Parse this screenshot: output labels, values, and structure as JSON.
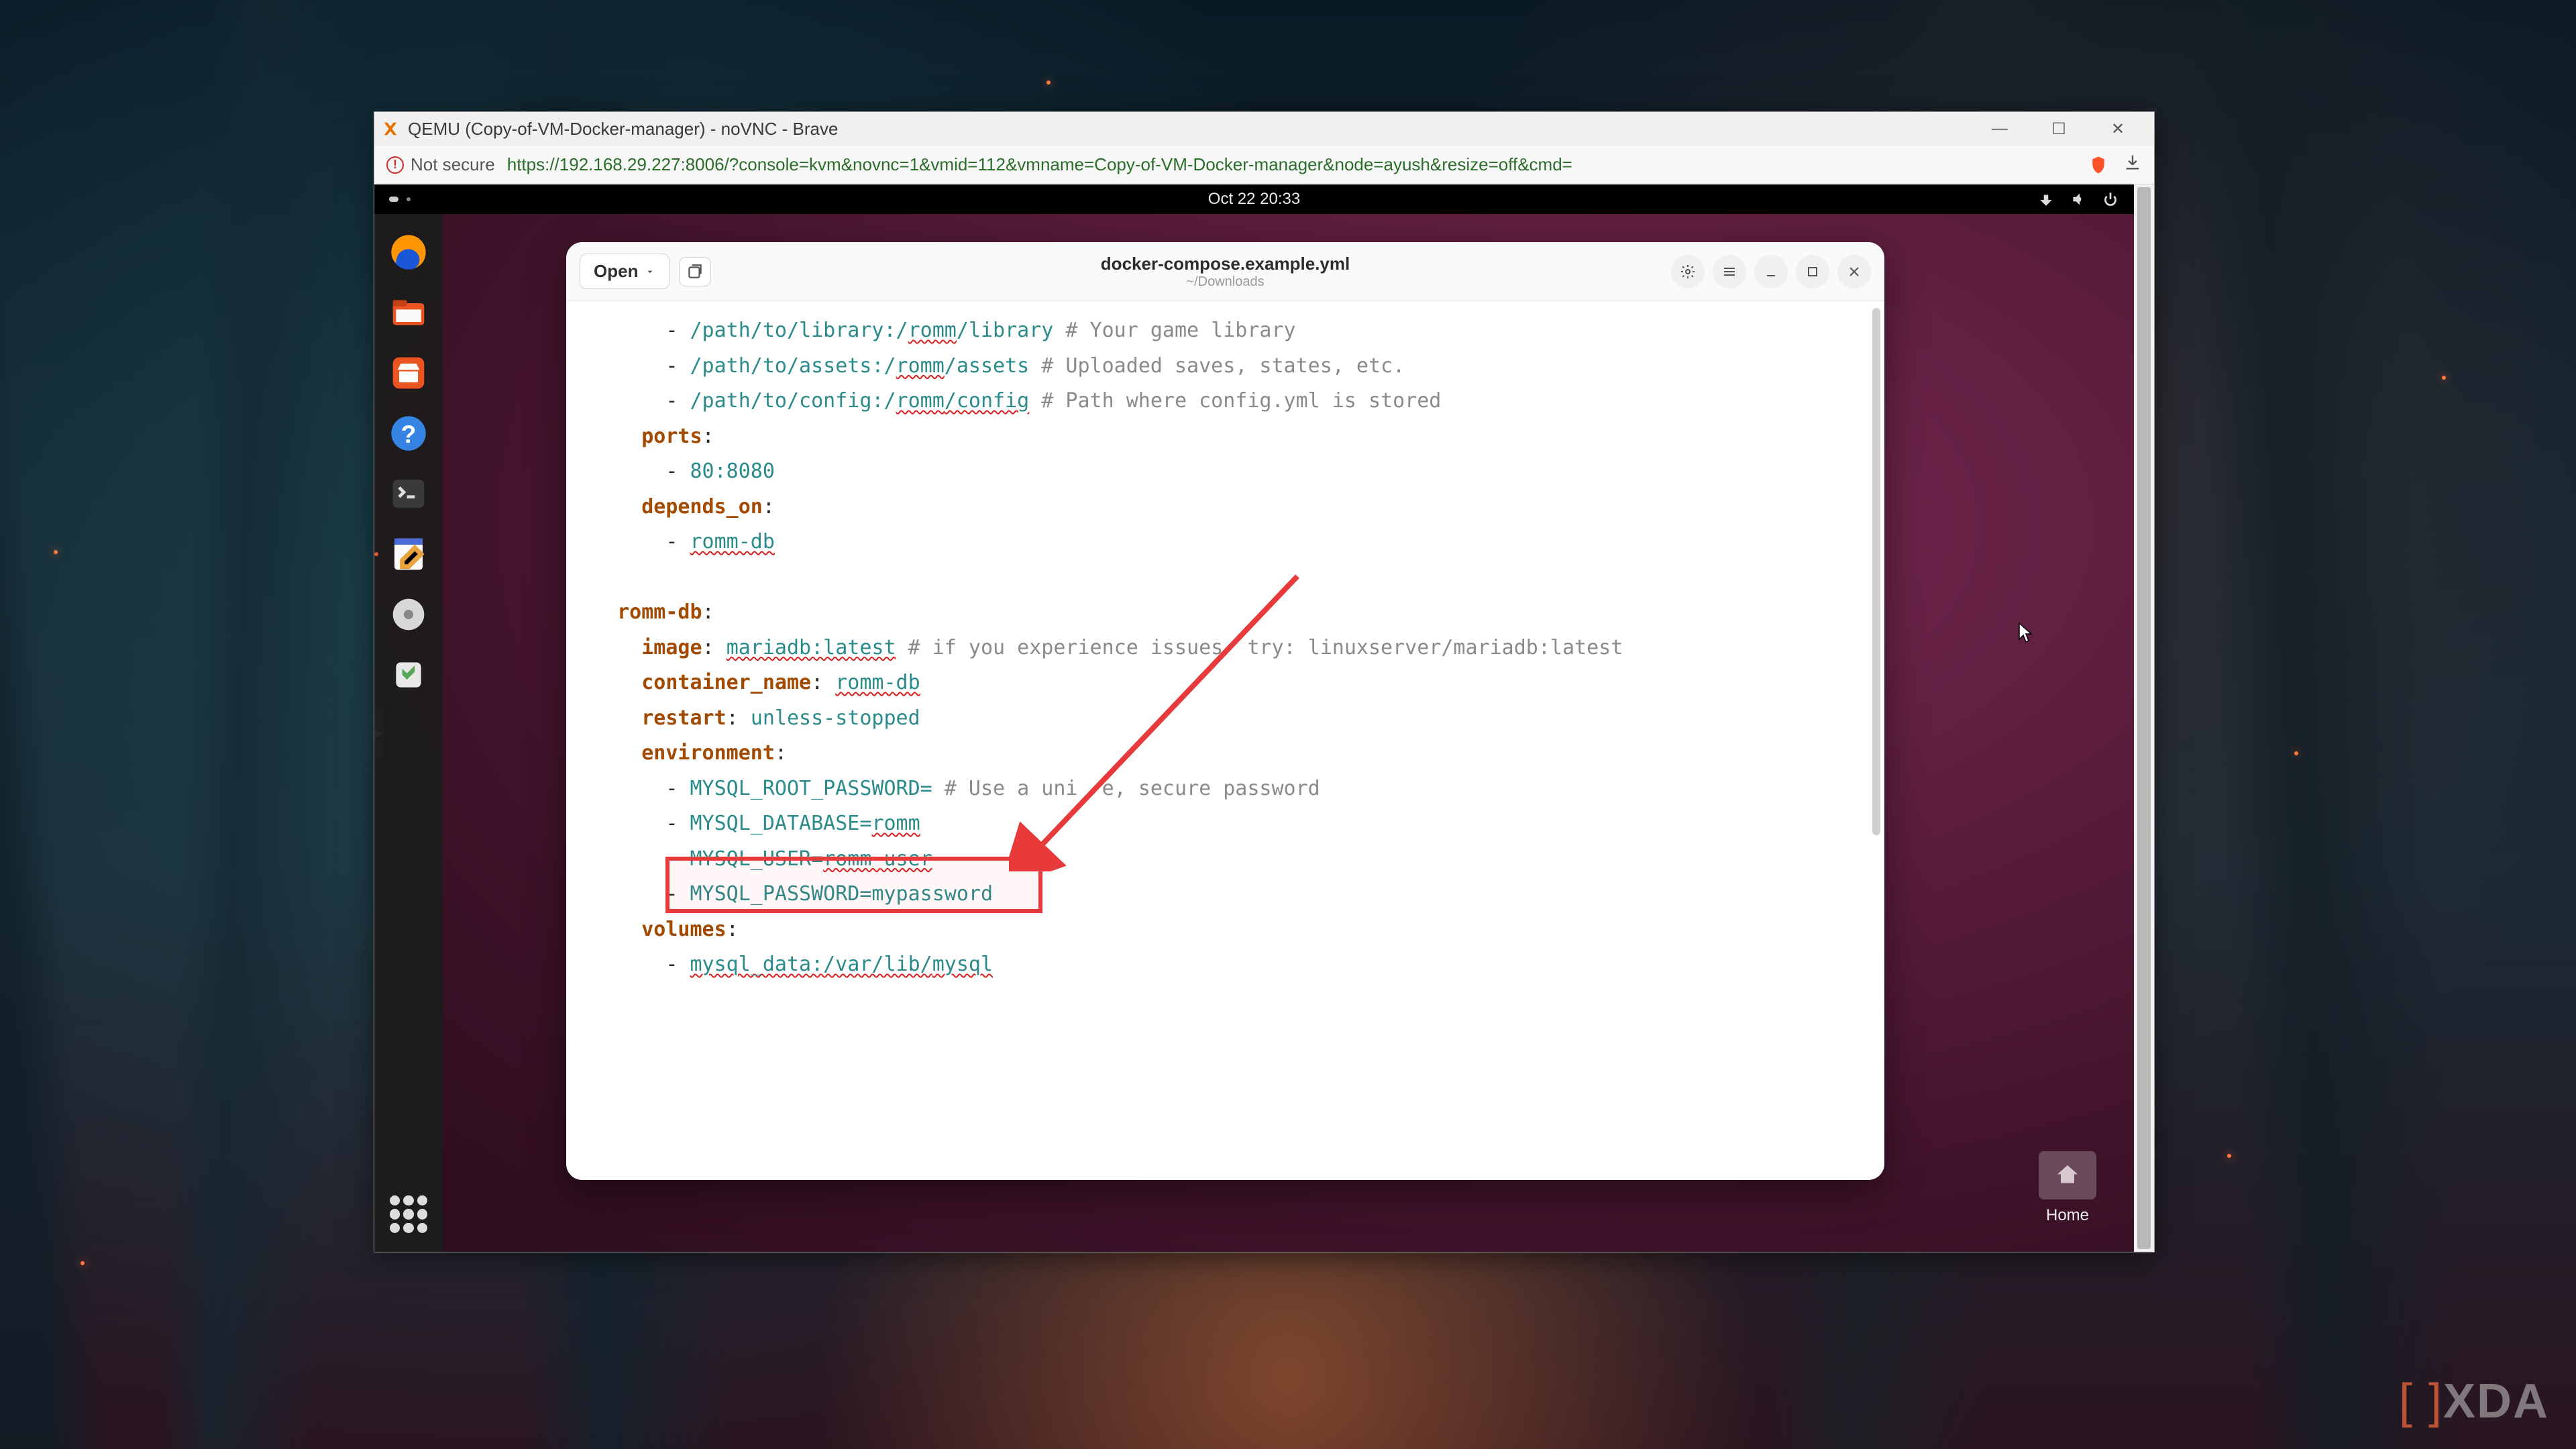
{
  "browser": {
    "title": "QEMU (Copy-of-VM-Docker-manager) - noVNC - Brave",
    "not_secure_label": "Not secure",
    "url": "https://192.168.29.227:8006/?console=kvm&novnc=1&vmid=112&vmname=Copy-of-VM-Docker-manager&node=ayush&resize=off&cmd="
  },
  "gnome": {
    "clock": "Oct 22  20:33"
  },
  "desktop": {
    "home_label": "Home"
  },
  "editor": {
    "open_label": "Open",
    "filename": "docker-compose.example.yml",
    "filepath": "~/Downloads",
    "code": {
      "l1_path": "/path/to/library:/",
      "l1_romm": "romm",
      "l1_rest": "/library",
      "l1_cmt": " # Your game library",
      "l2_path": "/path/to/assets:/",
      "l2_romm": "romm",
      "l2_rest": "/assets",
      "l2_cmt": " # Uploaded saves, states, etc.",
      "l3_path": "/path/to/config:/",
      "l3_romm": "romm",
      "l3_rest": "/config",
      "l3_cmt": " # Path where config.yml is stored",
      "ports_key": "ports",
      "ports_val": "80:8080",
      "depends_key": "depends_on",
      "depends_val": "romm-db",
      "rommdb_key": "romm-db",
      "image_key": "image",
      "image_val": "mariadb:latest",
      "image_cmt": " # if you experience issues  try: linuxserver/mariadb:latest",
      "cname_key": "container_name",
      "cname_val": "romm-db",
      "restart_key": "restart",
      "restart_val": "unless-stopped",
      "env_key": "environment",
      "env1": "MYSQL_ROOT_PASSWORD=",
      "env1_cmt": " # Use a uni  e, secure password",
      "env2_a": "MYSQL_DATABASE=",
      "env2_b": "romm",
      "env3_a": "MYSQL_USER=",
      "env3_b": "romm-user",
      "env4": "MYSQL_PASSWORD=mypassword",
      "vol_key": "volumes",
      "vol_val_a": "mysql_data:/var/lib/",
      "vol_val_b": "mysql"
    }
  },
  "watermark": "XDA"
}
